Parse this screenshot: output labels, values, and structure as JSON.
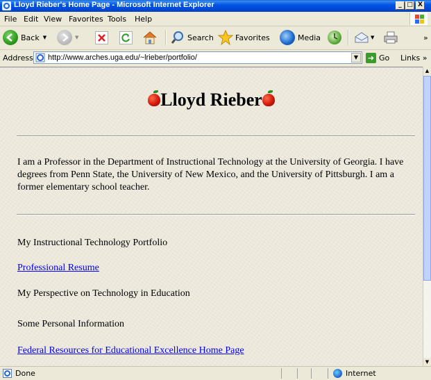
{
  "window": {
    "title": "Lloyd Rieber's Home Page - Microsoft Internet Explorer",
    "controls": {
      "minimize": "_",
      "maximize": "□",
      "close": "X"
    }
  },
  "menu": {
    "items": [
      {
        "label": "File"
      },
      {
        "label": "Edit"
      },
      {
        "label": "View"
      },
      {
        "label": "Favorites"
      },
      {
        "label": "Tools"
      },
      {
        "label": "Help"
      }
    ]
  },
  "toolbar": {
    "back_label": "Back",
    "search_label": "Search",
    "favorites_label": "Favorites",
    "media_label": "Media",
    "overflow": "»"
  },
  "address": {
    "label": "Address",
    "url": "http://www.arches.uga.edu/~lrieber/portfolio/",
    "go_label": "Go",
    "links_label": "Links",
    "links_overflow": "»"
  },
  "page": {
    "heading": "Lloyd Rieber",
    "intro": "I am a Professor in the Department of Instructional Technology at the University of Georgia. I have degrees from Penn State, the University of New Mexico, and the University of Pittsburgh. I am a former elementary school teacher.",
    "items": [
      {
        "text": "My Instructional Technology Portfolio",
        "link": false
      },
      {
        "text": "Professional Resume",
        "link": true
      },
      {
        "text": "My Perspective on Technology in Education",
        "link": false
      },
      {
        "text": "Some Personal Information",
        "link": false
      },
      {
        "text": "Federal Resources for Educational Excellence Home Page",
        "link": true
      }
    ]
  },
  "status": {
    "text": "Done",
    "zone": "Internet"
  },
  "colors": {
    "titlebar": "#0055e5",
    "link": "#0000ee",
    "chrome": "#ECE9D8"
  }
}
